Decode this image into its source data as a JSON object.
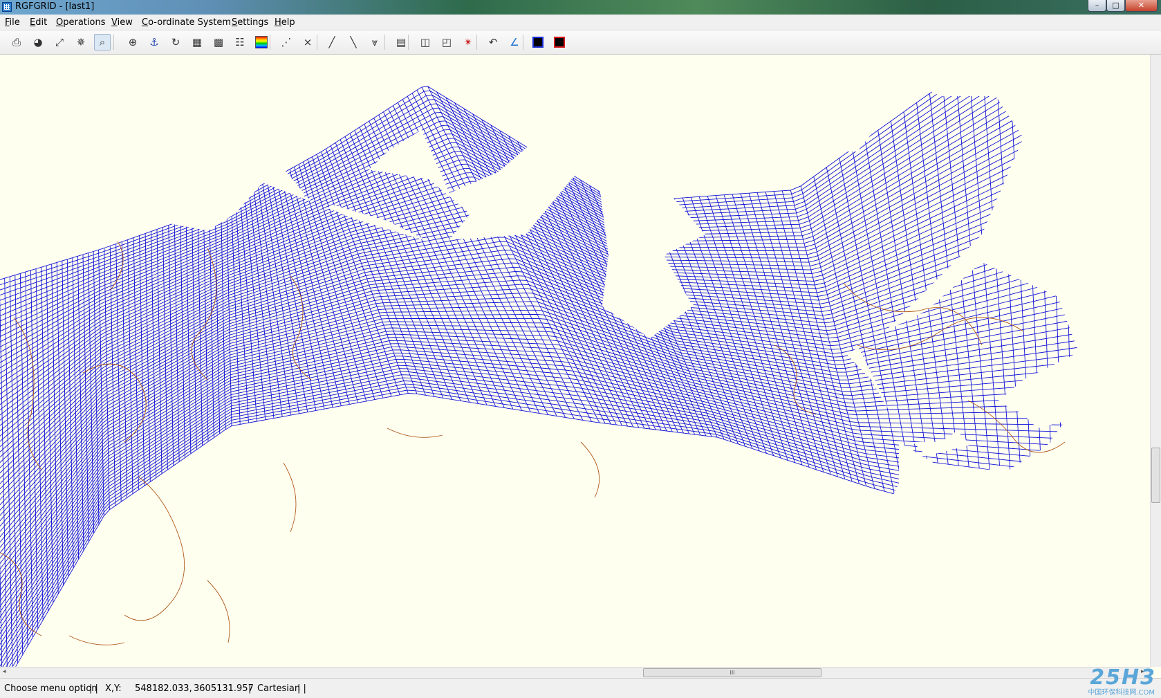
{
  "window": {
    "title": "RGFGRID - [last1]",
    "minimize_glyph": "–",
    "maximize_glyph": "□",
    "close_glyph": "✕"
  },
  "menu": [
    {
      "label": "File",
      "accel": "F",
      "rest": "ile"
    },
    {
      "label": "Edit",
      "accel": "E",
      "rest": "dit"
    },
    {
      "label": "Operations",
      "accel": "O",
      "rest": "perations"
    },
    {
      "label": "View",
      "accel": "V",
      "rest": "iew"
    },
    {
      "label": "Co-ordinate System",
      "accel": "C",
      "rest": "o-ordinate System"
    },
    {
      "label": "Settings",
      "accel": "S",
      "rest": "ettings"
    },
    {
      "label": "Help",
      "accel": "H",
      "rest": "elp"
    }
  ],
  "toolbar": [
    {
      "icon": "print-icon",
      "glyph": "⎙"
    },
    {
      "icon": "globe-icon",
      "glyph": "◕"
    },
    {
      "icon": "zoom-extents-icon",
      "glyph": "⤢"
    },
    {
      "icon": "zoom-in-arrows-icon",
      "glyph": "✵"
    },
    {
      "icon": "zoom-box-icon",
      "glyph": "⌕",
      "active": true
    },
    {
      "icon": "crosshair-icon",
      "glyph": "⊕"
    },
    {
      "icon": "anchor-icon",
      "glyph": "⚓"
    },
    {
      "icon": "refresh-icon",
      "glyph": "↻"
    },
    {
      "icon": "grid-pattern-icon",
      "glyph": "▦"
    },
    {
      "icon": "grid-pattern-2-icon",
      "glyph": "▩"
    },
    {
      "icon": "list-icon",
      "glyph": "☷"
    },
    {
      "icon": "color-scale-icon",
      "glyph": "█"
    },
    {
      "icon": "spline-points-icon",
      "glyph": "⋰"
    },
    {
      "icon": "delete-spline-icon",
      "glyph": "⨯"
    },
    {
      "icon": "spline-edit-icon",
      "glyph": "╱"
    },
    {
      "icon": "spline-insert-icon",
      "glyph": "╲"
    },
    {
      "icon": "spline-split-icon",
      "glyph": "⩔"
    },
    {
      "icon": "grid-icon",
      "glyph": "▤"
    },
    {
      "icon": "grid-refine-icon",
      "glyph": "◫"
    },
    {
      "icon": "grid-orthogonalise-icon",
      "glyph": "◰"
    },
    {
      "icon": "grid-star-icon",
      "glyph": "✴"
    },
    {
      "icon": "undo-arc-icon",
      "glyph": "↶"
    },
    {
      "icon": "angle-icon",
      "glyph": "∠"
    },
    {
      "icon": "dark-box-icon",
      "glyph": "▣"
    },
    {
      "icon": "dark-grid-box-icon",
      "glyph": "▩"
    }
  ],
  "colors": {
    "grid_line": "#1010d8",
    "land_boundary": "#b05a1a",
    "canvas_bg": "#fffff0",
    "color_scale": [
      "#ff0000",
      "#ff9900",
      "#ffff00",
      "#00cc00",
      "#00bbff",
      "#0000ff"
    ]
  },
  "statusbar": {
    "message": "Choose menu option",
    "coord_label": "X,Y:",
    "x": "548182.033,",
    "y": "3605131.957",
    "coord_system": "Cartesian"
  },
  "scrollbar": {
    "thumb_grip": "III"
  },
  "watermark": {
    "logo": "25H3",
    "text": "中国环保科技网.COM"
  }
}
